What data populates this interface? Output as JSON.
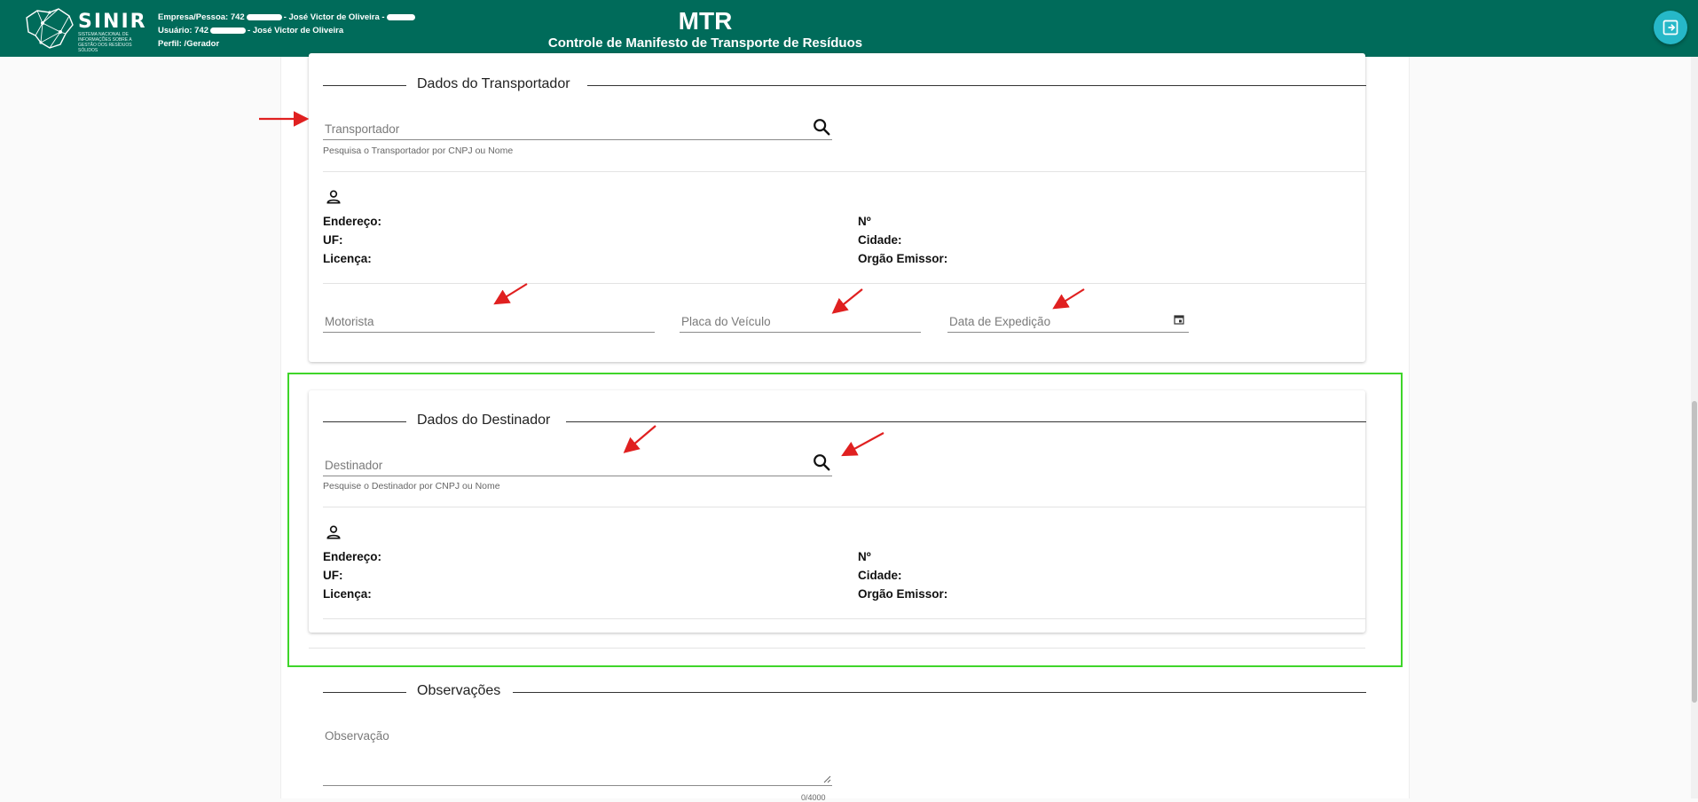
{
  "header": {
    "logo_text": "SINIR",
    "logo_subtitle": "SISTEMA NACIONAL DE INFORMAÇÕES SOBRE A GESTÃO DOS RESÍDUOS SÓLIDOS",
    "empresa_label": "Empresa/Pessoa: 742",
    "empresa_name": "- José Victor de Oliveira -",
    "usuario_label": "Usuário: 742",
    "usuario_name": "- José Victor de Oliveira",
    "perfil": "Perfil: /Gerador",
    "title": "MTR",
    "subtitle": "Controle de Manifesto de Transporte de Resíduos",
    "logout_icon": "logout-icon"
  },
  "transportador": {
    "section_title": "Dados do Transportador",
    "search_placeholder": "Transportador",
    "search_hint": "Pesquisa o Transportador por CNPJ ou Nome",
    "endereco_label": "Endereço:",
    "uf_label": "UF:",
    "licenca_label": "Licença:",
    "numero_label": "Nº",
    "cidade_label": "Cidade:",
    "orgao_label": "Orgão Emissor:",
    "motorista_placeholder": "Motorista",
    "placa_placeholder": "Placa do Veículo",
    "data_placeholder": "Data de Expedição"
  },
  "destinador": {
    "section_title": "Dados do Destinador",
    "search_placeholder": "Destinador",
    "search_hint": "Pesquise o Destinador por CNPJ ou Nome",
    "endereco_label": "Endereço:",
    "uf_label": "UF:",
    "licenca_label": "Licença:",
    "numero_label": "Nº",
    "cidade_label": "Cidade:",
    "orgao_label": "Orgão Emissor:"
  },
  "observacoes": {
    "section_title": "Observações",
    "placeholder": "Observação",
    "counter": "0/4000"
  },
  "colors": {
    "header_bg": "#006b5a",
    "logout_bg": "#26b8c8",
    "highlight": "#3fd52a",
    "arrow": "#e02020"
  }
}
